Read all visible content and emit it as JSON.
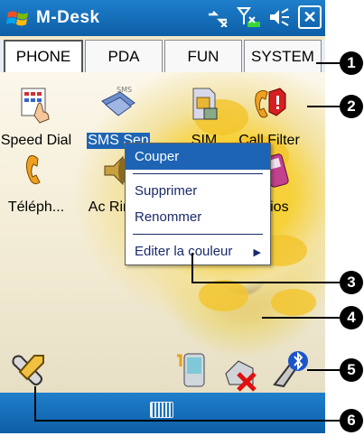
{
  "titlebar": {
    "title": "M-Desk",
    "close_label": "✕"
  },
  "tabs": [
    {
      "label": "PHONE",
      "active": true
    },
    {
      "label": "PDA",
      "active": false
    },
    {
      "label": "FUN",
      "active": false
    },
    {
      "label": "SYSTEM",
      "active": false
    }
  ],
  "desktop_icons": [
    {
      "label": "Speed Dial",
      "icon": "speed-dial-icon",
      "selected": false
    },
    {
      "label": "SMS Sen",
      "icon": "sms-icon",
      "selected": true
    },
    {
      "label": "SIM",
      "icon": "sim-icon",
      "selected": false
    },
    {
      "label": "Call Filter",
      "icon": "call-filter-icon",
      "selected": false
    },
    {
      "label": "Téléph...",
      "icon": "phone-icon",
      "selected": false
    },
    {
      "label": "Ac Ringt",
      "icon": "ringtone-icon",
      "selected": false
    },
    {
      "label": "narios",
      "icon": "scenarios-icon",
      "selected": false
    }
  ],
  "context_menu": {
    "items": [
      "Couper",
      "Supprimer",
      "Renommer",
      "Editer la couleur"
    ],
    "active_index": 0
  },
  "callouts": [
    "1",
    "2",
    "3",
    "4",
    "5",
    "6"
  ],
  "colors": {
    "accent": "#1e64b4",
    "titlebar": "#0d5ea6"
  }
}
